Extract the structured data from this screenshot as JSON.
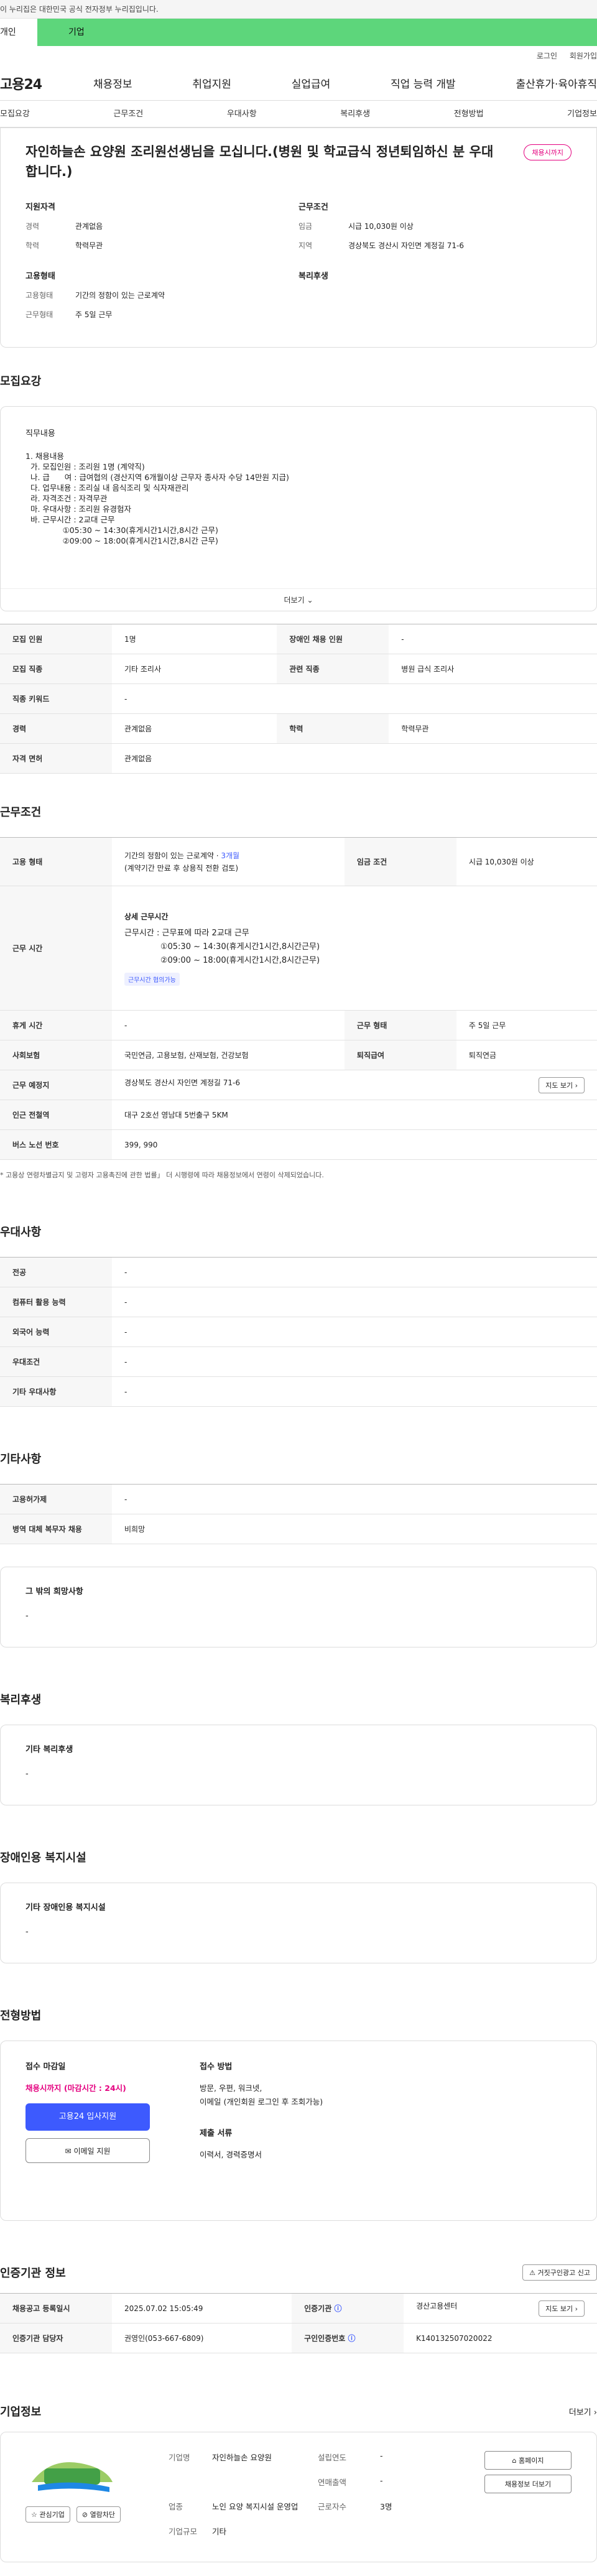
{
  "gov_bar": "이 누리집은 대한민국 공식 전자정부 누리집입니다.",
  "top_tabs": {
    "individual": "개인",
    "business": "기업"
  },
  "util": {
    "login": "로그인",
    "signup": "회원가입"
  },
  "gnb": {
    "logo": "고용24",
    "menu": [
      "채용정보",
      "취업지원",
      "실업급여",
      "직업 능력 개발",
      "출산휴가·육아휴직"
    ]
  },
  "subnav": [
    "모집요강",
    "근무조건",
    "우대사항",
    "복리후생",
    "전형방법",
    "기업정보"
  ],
  "summary": {
    "title": "자인하늘손 요양원 조리원선생님을 모십니다.(병원 및 학교급식 정년퇴임하신 분 우대합니다.)",
    "status_badge": "채용시까지",
    "qual_heading": "지원자격",
    "career_k": "경력",
    "career_v": "관계없음",
    "edu_k": "학력",
    "edu_v": "학력무관",
    "cond_heading": "근무조건",
    "wage_k": "임금",
    "wage_v": "시급 10,030원 이상",
    "region_k": "지역",
    "region_v": "경상북도 경산시 자인면 계정길 71-6",
    "emp_heading": "고용형태",
    "type_k": "고용형태",
    "type_v": "기간의 정함이 있는 근로계약",
    "form_k": "근무형태",
    "form_v": "주 5일 근무",
    "welfare_heading": "복리후생"
  },
  "recruit": {
    "section": "모집요강",
    "duty_label": "직무내용",
    "body": "1. 채용내용\n  가. 모집인원 : 조리원 1명 (계약직)\n  나. 급      여 : 급여협의 (경산지역 6개월이상 근무자 종사자 수당 14만원 지급)\n  다. 업무내용 : 조리실 내 음식조리 및 식자재관리\n  라. 자격조건 : 자격무관\n  마. 우대사항 : 조리원 유경험자\n  바. 근무시간 : 2교대 근무\n               ①05:30 ~ 14:30(휴게시간1시간,8시간 근무)\n               ②09:00 ~ 18:00(휴게시간1시간,8시간 근무)",
    "more": "더보기",
    "rows": {
      "people_k": "모집 인원",
      "people_v": "1명",
      "disabled_k": "장애인 채용 인원",
      "disabled_v": "-",
      "job_k": "모집 직종",
      "job_v": "기타 조리사",
      "related_k": "관련 직종",
      "related_v": "병원 급식 조리사",
      "keyword_k": "직종 키워드",
      "keyword_v": "-",
      "career_k": "경력",
      "career_v": "관계없음",
      "edu_k": "학력",
      "edu_v": "학력무관",
      "license_k": "자격 면허",
      "license_v": "관계없음"
    }
  },
  "work": {
    "section": "근무조건",
    "type_k": "고용 형태",
    "type_v1": "기간의 정함이 있는 근로계약 · ",
    "type_months": "3개월",
    "type_v2": "(계약기간 만료 후 상용직 전환 검토)",
    "wage_k": "임금 조건",
    "wage_v": "시급 10,030원 이상",
    "hours_k": "근무 시간",
    "hours_title": "상세 근무시간",
    "hours_body": "근무시간 : 근무표에 따라 2교대 근무\n              ①05:30 ~ 14:30(휴게시간1시간,8시간근무)\n              ②09:00 ~ 18:00(휴게시간1시간,8시간근무)",
    "hours_tag": "근무시간 협의가능",
    "rest_k": "휴게 시간",
    "rest_v": "-",
    "form_k": "근무 형태",
    "form_v": "주 5일 근무",
    "insure_k": "사회보험",
    "insure_v": "국민연금, 고용보험, 산재보험, 건강보험",
    "retire_k": "퇴직급여",
    "retire_v": "퇴직연금",
    "place_k": "근무 예정지",
    "place_v": "경상북도 경산시 자인면 계정길 71-6",
    "map_btn": "지도 보기",
    "subway_k": "인근 전철역",
    "subway_v": "대구 2호선 영남대 5번출구 5KM",
    "bus_k": "버스 노선 번호",
    "bus_v": "399, 990",
    "note": "* 고용상 연령차별금지 및 고령자 고용촉진에 관한 법률」 더 시행령에 따라 채용정보에서 연령이 삭제되었습니다."
  },
  "pref": {
    "section": "우대사항",
    "rows": [
      {
        "k": "전공",
        "v": "-"
      },
      {
        "k": "컴퓨터 활용 능력",
        "v": "-"
      },
      {
        "k": "외국어 능력",
        "v": "-"
      },
      {
        "k": "우대조건",
        "v": "-"
      },
      {
        "k": "기타 우대사항",
        "v": "-"
      }
    ]
  },
  "etc": {
    "section": "기타사항",
    "rows": [
      {
        "k": "고용허가제",
        "v": "-"
      },
      {
        "k": "병역 대체 복무자 채용",
        "v": "비희망"
      }
    ],
    "other_label": "그 밖의 희망사항",
    "other_v": "-"
  },
  "welfare": {
    "section": "복리후생",
    "label": "기타 복리후생",
    "v": "-"
  },
  "disability": {
    "section": "장애인용 복지시설",
    "label": "기타 장애인용 복지시설",
    "v": "-"
  },
  "screening": {
    "section": "전형방법",
    "deadline_label": "접수 마감일",
    "deadline_v": "채용시까지 (마감시간 : 24시)",
    "apply_btn": "고용24 입사지원",
    "mail_btn": "이메일 지원",
    "method_label": "접수 방법",
    "method_v": "방문, 우편, 워크넷,\n이메일 (개인회원 로그인 후 조회가능)",
    "docs_label": "제출 서류",
    "docs_v": "이력서, 경력증명서"
  },
  "agency": {
    "section": "인증기관 정보",
    "report_btn": "거짓구인광고 신고",
    "reg_k": "채용공고 등록일시",
    "reg_v": "2025.07.02 15:05:49",
    "cert_k": "인증기관",
    "cert_v": "경산고용센터",
    "map_btn": "지도 보기",
    "mgr_k": "인증기관 담당자",
    "mgr_v": "권영인(053-667-6809)",
    "num_k": "구인인증번호",
    "num_v": "K140132507020022"
  },
  "company": {
    "section": "기업정보",
    "more": "더보기",
    "fav_btn": "관심기업",
    "block_btn": "열람차단",
    "name_k": "기업명",
    "name_v": "자인하늘손 요양원",
    "est_k": "설립연도",
    "est_v": "-",
    "sales_k": "연매출액",
    "sales_v": "-",
    "ind_k": "업종",
    "ind_v": "노인 요양 복지시설 운영업",
    "staff_k": "근로자수",
    "staff_v": "3명",
    "scale_k": "기업규모",
    "scale_v": "기타",
    "home_btn": "홈페이지",
    "info_btn": "채용정보 더보기"
  }
}
